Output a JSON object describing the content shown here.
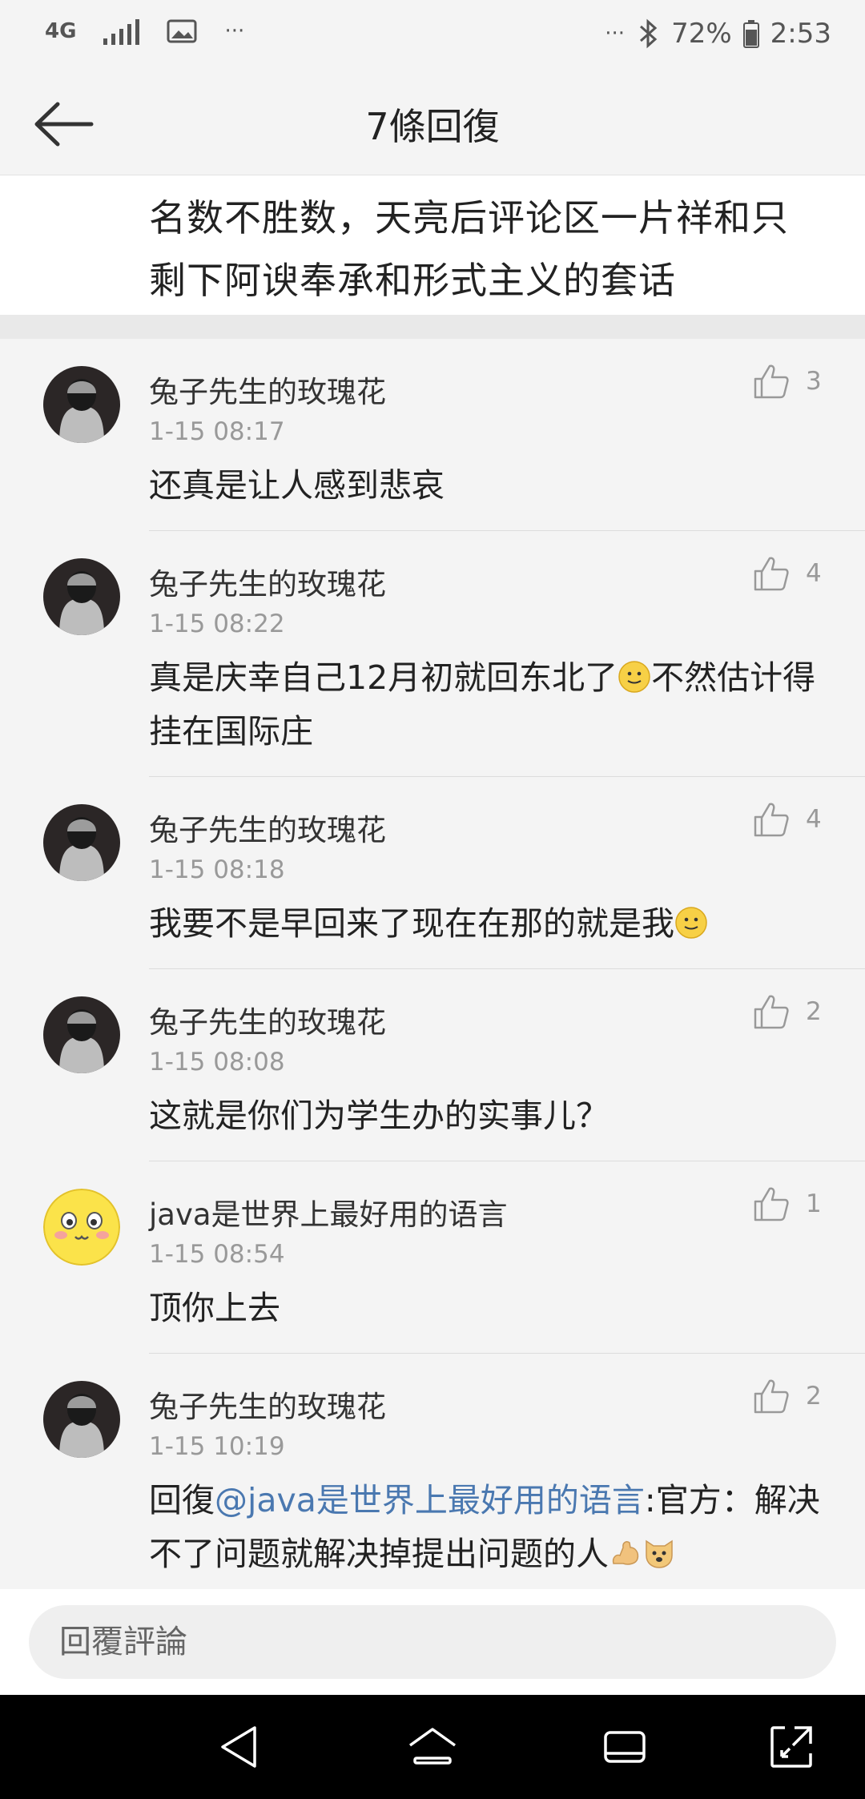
{
  "status_bar": {
    "network": "4G",
    "battery_percent": "72%",
    "time": "2:53",
    "left_more": "···",
    "right_more": "···"
  },
  "header": {
    "title": "7條回復"
  },
  "original_comment": {
    "text": "名数不胜数，天亮后评论区一片祥和只剩下阿谀奉承和形式主义的套话"
  },
  "replies": [
    {
      "user": "兔子先生的玫瑰花",
      "time": "1-15 08:17",
      "likes": "3",
      "text": "还真是让人感到悲哀"
    },
    {
      "user": "兔子先生的玫瑰花",
      "time": "1-15 08:22",
      "likes": "4",
      "text_before": "真是庆幸自己12月初就回东北了",
      "text_after": "不然估计得挂在国际庄"
    },
    {
      "user": "兔子先生的玫瑰花",
      "time": "1-15 08:18",
      "likes": "4",
      "text": "我要不是早回来了现在在那的就是我"
    },
    {
      "user": "兔子先生的玫瑰花",
      "time": "1-15 08:08",
      "likes": "2",
      "text": "这就是你们为学生办的实事儿？"
    },
    {
      "user": "java是世界上最好用的语言",
      "time": "1-15 08:54",
      "likes": "1",
      "text": "顶你上去"
    },
    {
      "user": "兔子先生的玫瑰花",
      "time": "1-15 10:19",
      "likes": "2",
      "prefix": "回復",
      "mention": "@java是世界上最好用的语言",
      "text": ":官方：解决不了问题就解决掉提出问题的人"
    }
  ],
  "reply_input": {
    "placeholder": "回覆評論"
  },
  "colors": {
    "mention": "#4a78b0",
    "background": "#f4f4f4"
  }
}
